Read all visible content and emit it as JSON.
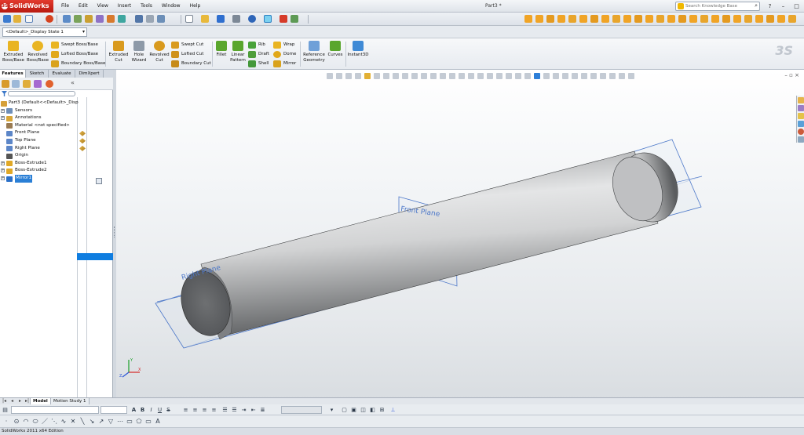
{
  "app": {
    "name": "SolidWorks",
    "doc_title": "Part3 *",
    "menus": [
      "File",
      "Edit",
      "View",
      "Insert",
      "Tools",
      "Window",
      "Help"
    ],
    "search_placeholder": "Search Knowledge Base",
    "window_controls": [
      "?",
      "–",
      "□",
      "×"
    ]
  },
  "config": {
    "selected": "<Default>_Display State 1"
  },
  "command_manager": {
    "big": [
      {
        "label": "Extruded\nBoss/Base",
        "icon": "extruded-boss-icon",
        "color": "#e9b422"
      },
      {
        "label": "Revolved\nBoss/Base",
        "icon": "revolved-boss-icon",
        "color": "#e9b422"
      },
      {
        "label": "Extruded\nCut",
        "icon": "extruded-cut-icon",
        "color": "#d99a1e"
      },
      {
        "label": "Hole\nWizard",
        "icon": "hole-wizard-icon",
        "color": "#8e9aa8"
      },
      {
        "label": "Revolved\nCut",
        "icon": "revolved-cut-icon",
        "color": "#d99a1e"
      },
      {
        "label": "Fillet",
        "icon": "fillet-icon",
        "color": "#5aa62d"
      },
      {
        "label": "Linear\nPattern",
        "icon": "linear-pattern-icon",
        "color": "#5aa62d"
      },
      {
        "label": "Reference\nGeometry",
        "icon": "reference-geometry-icon",
        "color": "#6fa0d8"
      },
      {
        "label": "Curves",
        "icon": "curves-icon",
        "color": "#5aa62d"
      },
      {
        "label": "Instant3D",
        "icon": "instant3d-icon",
        "color": "#3f8ad6"
      }
    ],
    "small": [
      {
        "label": "Swept Boss/Base",
        "icon": "swept-boss-icon"
      },
      {
        "label": "Lofted Boss/Base",
        "icon": "lofted-boss-icon"
      },
      {
        "label": "Boundary Boss/Base",
        "icon": "boundary-boss-icon"
      },
      {
        "label": "Swept Cut",
        "icon": "swept-cut-icon"
      },
      {
        "label": "Lofted Cut",
        "icon": "lofted-cut-icon"
      },
      {
        "label": "Boundary Cut",
        "icon": "boundary-cut-icon"
      },
      {
        "label": "Rib",
        "icon": "rib-icon"
      },
      {
        "label": "Draft",
        "icon": "draft-icon"
      },
      {
        "label": "Shell",
        "icon": "shell-icon"
      },
      {
        "label": "Wrap",
        "icon": "wrap-icon"
      },
      {
        "label": "Dome",
        "icon": "dome-icon"
      },
      {
        "label": "Mirror",
        "icon": "mirror-icon"
      }
    ]
  },
  "tabs": [
    "Features",
    "Sketch",
    "Evaluate",
    "DimXpert"
  ],
  "feature_tree": [
    {
      "label": "Part3  (Default<<Default>_Disp",
      "icon": "part-icon",
      "exp": "",
      "root": true
    },
    {
      "label": "Sensors",
      "icon": "sensors-icon",
      "exp": "+"
    },
    {
      "label": "Annotations",
      "icon": "annotations-icon",
      "exp": "+"
    },
    {
      "label": "Material <not specified>",
      "icon": "material-icon",
      "exp": ""
    },
    {
      "label": "Front Plane",
      "icon": "plane-icon",
      "exp": ""
    },
    {
      "label": "Top Plane",
      "icon": "plane-icon",
      "exp": ""
    },
    {
      "label": "Right Plane",
      "icon": "plane-icon",
      "exp": ""
    },
    {
      "label": "Origin",
      "icon": "origin-icon",
      "exp": ""
    },
    {
      "label": "Boss-Extrude1",
      "icon": "boss-extrude-icon",
      "exp": "+"
    },
    {
      "label": "Boss-Extrude2",
      "icon": "boss-extrude-icon",
      "exp": "+"
    },
    {
      "label": "Mirror1",
      "icon": "mirror-feature-icon",
      "exp": "+",
      "selected": true
    }
  ],
  "viewport": {
    "plane_labels": {
      "front": "Front Plane",
      "right": "Right Plane"
    },
    "triad": {
      "x": "X",
      "y": "Y",
      "z": "Z"
    }
  },
  "bottom_tabs": [
    "Model",
    "Motion Study 1"
  ],
  "status": "SolidWorks 2011 x64 Edition"
}
